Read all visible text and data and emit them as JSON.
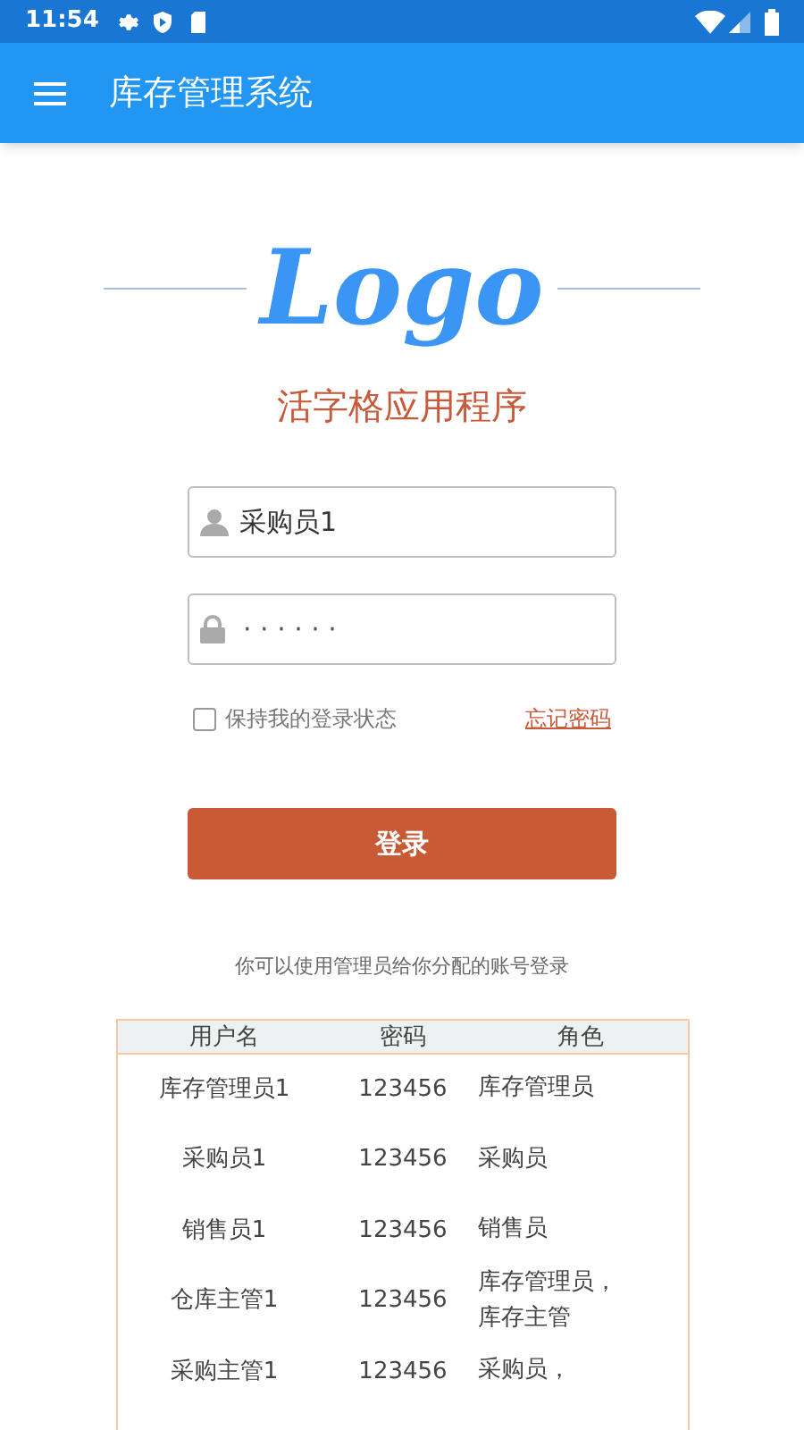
{
  "status_bar": {
    "time": "11:54"
  },
  "app_bar": {
    "title": "库存管理系统"
  },
  "logo": "Logo",
  "subtitle": "活字格应用程序",
  "username": {
    "value": "采购员1"
  },
  "password": {
    "value": "· · · · · ·"
  },
  "remember": {
    "label": "保持我的登录状态",
    "checked": false
  },
  "forgot_link": "忘记密码",
  "login_button": "登录",
  "hint": "你可以使用管理员给你分配的账号登录",
  "table": {
    "columns": [
      "用户名",
      "密码",
      "角色"
    ],
    "rows": [
      [
        "库存管理员1",
        "123456",
        "库存管理员"
      ],
      [
        "采购员1",
        "123456",
        "采购员"
      ],
      [
        "销售员1",
        "123456",
        "销售员"
      ],
      [
        "仓库主管1",
        "123456",
        "库存管理员，库存主管"
      ],
      [
        "采购主管1",
        "123456",
        "采购员，"
      ]
    ]
  }
}
